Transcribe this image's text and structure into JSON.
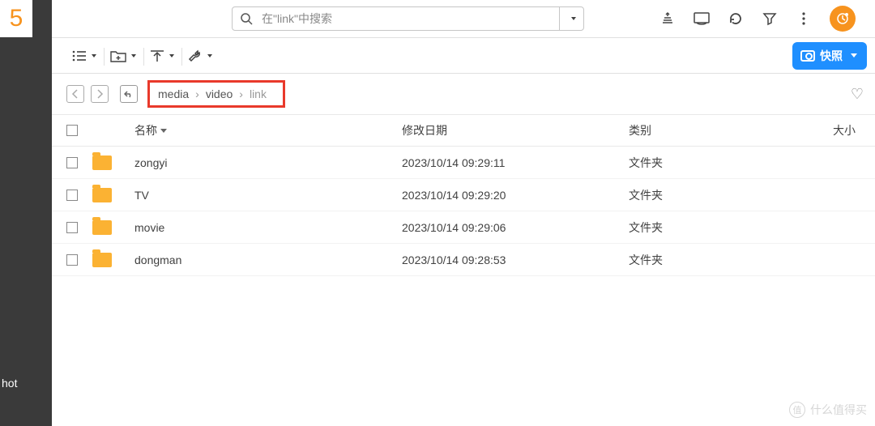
{
  "logo_digit": "5",
  "sidebar_label": "hot",
  "search": {
    "placeholder": "在\"link\"中搜索"
  },
  "snapshot_button": "快照",
  "breadcrumb": [
    "media",
    "video",
    "link"
  ],
  "columns": {
    "name": "名称",
    "date": "修改日期",
    "type": "类别",
    "size": "大小"
  },
  "rows": [
    {
      "name": "zongyi",
      "date": "2023/10/14 09:29:11",
      "type": "文件夹"
    },
    {
      "name": "TV",
      "date": "2023/10/14 09:29:20",
      "type": "文件夹"
    },
    {
      "name": "movie",
      "date": "2023/10/14 09:29:06",
      "type": "文件夹"
    },
    {
      "name": "dongman",
      "date": "2023/10/14 09:28:53",
      "type": "文件夹"
    }
  ],
  "watermark": "什么值得买"
}
